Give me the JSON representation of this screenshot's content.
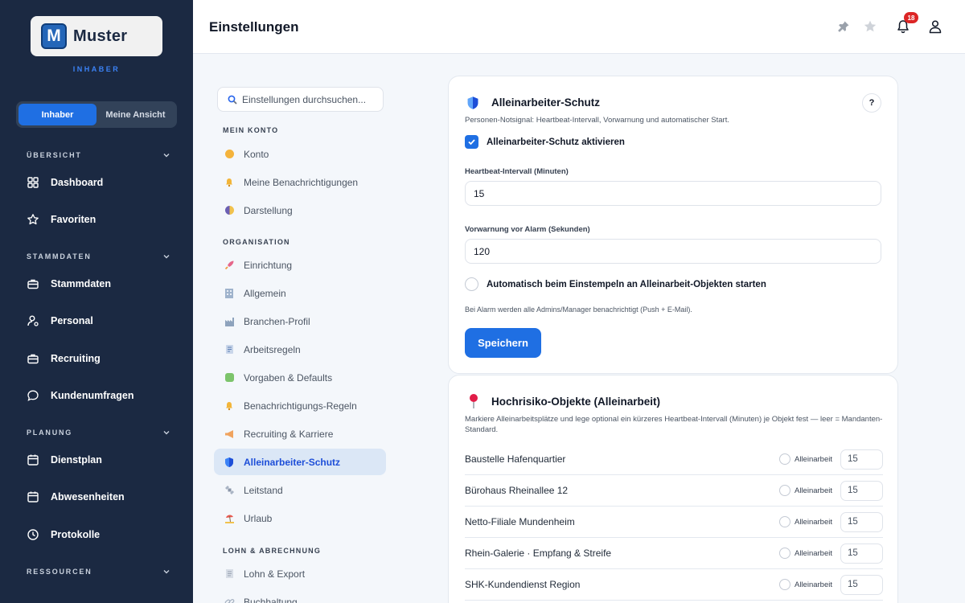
{
  "brand": {
    "name": "Muster",
    "mark": "M",
    "role_caption": "INHABER"
  },
  "role_toggle": {
    "options": [
      "Inhaber",
      "Meine Ansicht"
    ],
    "active": "Inhaber"
  },
  "sidebar": {
    "sections": [
      {
        "title": "ÜBERSICHT",
        "items": [
          "Dashboard",
          "Favoriten"
        ]
      },
      {
        "title": "STAMMDATEN",
        "items": [
          "Stammdaten",
          "Personal",
          "Recruiting",
          "Kundenumfragen"
        ]
      },
      {
        "title": "PLANUNG",
        "items": [
          "Dienstplan",
          "Abwesenheiten",
          "Protokolle"
        ]
      },
      {
        "title": "RESSOURCEN",
        "items": []
      }
    ]
  },
  "header": {
    "title": "Einstellungen",
    "notification_count": "18"
  },
  "settings_nav": {
    "search_placeholder": "Einstellungen durchsuchen...",
    "sections": [
      {
        "title": "MEIN KONTO",
        "items": [
          "Konto",
          "Meine Benachrichtigungen",
          "Darstellung"
        ]
      },
      {
        "title": "ORGANISATION",
        "items": [
          "Einrichtung",
          "Allgemein",
          "Branchen-Profil",
          "Arbeitsregeln",
          "Vorgaben & Defaults",
          "Benachrichtigungs-Regeln",
          "Recruiting & Karriere",
          "Alleinarbeiter-Schutz",
          "Leitstand",
          "Urlaub"
        ]
      },
      {
        "title": "LOHN & ABRECHNUNG",
        "items": [
          "Lohn & Export",
          "Buchhaltung"
        ]
      }
    ],
    "active": "Alleinarbeiter-Schutz"
  },
  "lone_worker": {
    "title": "Alleinarbeiter-Schutz",
    "subtitle": "Personen-Notsignal: Heartbeat-Intervall, Vorwarnung und automatischer Start.",
    "help": "?",
    "enable_label": "Alleinarbeiter-Schutz aktivieren",
    "enabled": true,
    "heartbeat_label": "Heartbeat-Intervall (Minuten)",
    "heartbeat_value": "15",
    "prewarn_label": "Vorwarnung vor Alarm (Sekunden)",
    "prewarn_value": "120",
    "auto_start_label": "Automatisch beim Einstempeln an Alleinarbeit-Objekten starten",
    "auto_start": false,
    "hint": "Bei Alarm werden alle Admins/Manager benachrichtigt (Push + E-Mail).",
    "save_label": "Speichern"
  },
  "high_risk": {
    "title": "Hochrisiko-Objekte (Alleinarbeit)",
    "subtitle": "Markiere Alleinarbeitsplätze und lege optional ein kürzeres Heartbeat-Intervall (Minuten) je Objekt fest — leer = Mandanten-Standard.",
    "tag_label": "Alleinarbeit",
    "objects": [
      {
        "name": "Baustelle Hafenquartier",
        "interval": "15"
      },
      {
        "name": "Bürohaus Rheinallee 12",
        "interval": "15"
      },
      {
        "name": "Netto-Filiale Mundenheim",
        "interval": "15"
      },
      {
        "name": "Rhein-Galerie · Empfang & Streife",
        "interval": "15"
      },
      {
        "name": "SHK-Kundendienst Region",
        "interval": "15"
      }
    ]
  },
  "colors": {
    "sidebar": "#1b2942",
    "accent": "#1f6fe3",
    "badge": "#dc2626"
  }
}
